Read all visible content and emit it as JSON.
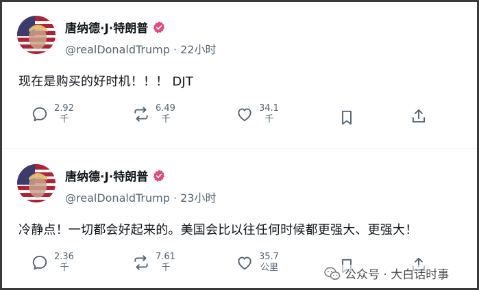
{
  "posts": [
    {
      "author_name": "唐纳德·J·特朗普",
      "handle_time": "@realDonaldTrump · 22小时",
      "text": "现在是购买的好时机！！！ DJT",
      "reply": {
        "count": "2.92",
        "unit": "千"
      },
      "repost": {
        "count": "6.49",
        "unit": "千"
      },
      "like": {
        "count": "34.1",
        "unit": "千"
      }
    },
    {
      "author_name": "唐纳德·J·特朗普",
      "handle_time": "@realDonaldTrump · 23小时",
      "text": "冷静点！一切都会好起来的。美国会比以往任何时候都更强大、更强大！",
      "reply": {
        "count": "2.36",
        "unit": "千"
      },
      "repost": {
        "count": "7.61",
        "unit": "千"
      },
      "like": {
        "count": "35.7",
        "unit": "公里"
      }
    }
  ],
  "icons": {
    "verified": "verified-badge-icon",
    "reply": "comment-icon",
    "repost": "repost-icon",
    "like": "heart-icon",
    "bookmark": "bookmark-icon",
    "share": "share-icon"
  },
  "colors": {
    "verified": "#e8477a",
    "text_secondary": "#536471"
  },
  "watermark": {
    "text": "公众号 · 大白话时事"
  }
}
